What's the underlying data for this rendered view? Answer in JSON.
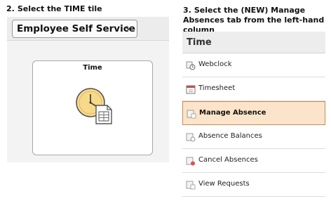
{
  "instructions": {
    "step2": {
      "number": "2.",
      "text": "Select the TIME tile"
    },
    "step3": {
      "number": "3.",
      "text": "Select the (NEW) Manage Absences tab from the left-hand column"
    }
  },
  "left_panel": {
    "selector_label": "Employee Self Service",
    "selector_icon": "chevron-down-icon",
    "tile": {
      "title": "Time",
      "icon": "clock-document-icon"
    }
  },
  "right_panel": {
    "title": "Time",
    "items": [
      {
        "label": "Webclock",
        "icon": "webclock-icon",
        "active": false
      },
      {
        "label": "Timesheet",
        "icon": "calendar-icon",
        "active": false
      },
      {
        "label": "Manage Absence",
        "icon": "absence-icon",
        "active": true
      },
      {
        "label": "Absence Balances",
        "icon": "balance-icon",
        "active": false
      },
      {
        "label": "Cancel Absences",
        "icon": "cancel-icon",
        "active": false
      },
      {
        "label": "View Requests",
        "icon": "requests-icon",
        "active": false
      }
    ]
  },
  "colors": {
    "active_bg": "#fbe4c9",
    "active_border": "#c48a57",
    "clock_face": "#f7d98a"
  }
}
